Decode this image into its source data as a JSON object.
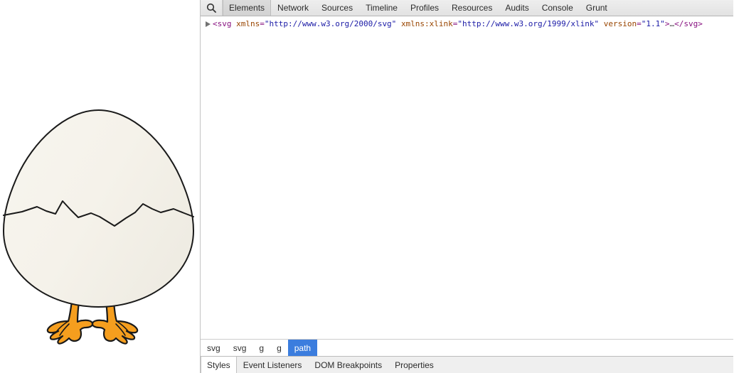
{
  "page": {
    "illustration": {
      "name": "cracked-egg-with-feet",
      "shell_fill": "#f5f2ea",
      "shell_stroke": "#1a1a1a",
      "feet_fill": "#f59e1e",
      "feet_stroke": "#1a1a1a"
    }
  },
  "devtools": {
    "search_icon": "search-icon",
    "tabs": [
      {
        "label": "Elements",
        "active": true
      },
      {
        "label": "Network",
        "active": false
      },
      {
        "label": "Sources",
        "active": false
      },
      {
        "label": "Timeline",
        "active": false
      },
      {
        "label": "Profiles",
        "active": false
      },
      {
        "label": "Resources",
        "active": false
      },
      {
        "label": "Audits",
        "active": false
      },
      {
        "label": "Console",
        "active": false
      },
      {
        "label": "Grunt",
        "active": false
      }
    ],
    "dom": {
      "twisty": "disclosure-triangle-collapsed-icon",
      "open_bracket": "<",
      "tag": "svg",
      "attributes": [
        {
          "name": "xmlns",
          "eq": "=",
          "value": "\"http://www.w3.org/2000/svg\""
        },
        {
          "name": "xmlns:xlink",
          "eq": "=",
          "value": "\"http://www.w3.org/1999/xlink\""
        },
        {
          "name": "version",
          "eq": "=",
          "value": "\"1.1\""
        }
      ],
      "close_bracket": ">",
      "ellipsis": "…",
      "close_tag": "</svg>"
    },
    "breadcrumbs": [
      {
        "label": "svg",
        "selected": false
      },
      {
        "label": "svg",
        "selected": false
      },
      {
        "label": "g",
        "selected": false
      },
      {
        "label": "g",
        "selected": false
      },
      {
        "label": "path",
        "selected": true
      }
    ],
    "sidebar_tabs": [
      {
        "label": "Styles",
        "active": true
      },
      {
        "label": "Event Listeners",
        "active": false
      },
      {
        "label": "DOM Breakpoints",
        "active": false
      },
      {
        "label": "Properties",
        "active": false
      }
    ],
    "colors": {
      "tag": "#881280",
      "attr_name": "#994500",
      "attr_value": "#1a1aa6",
      "selection": "#3b7dde",
      "toolbar_bg": "#e6e6e6"
    }
  }
}
